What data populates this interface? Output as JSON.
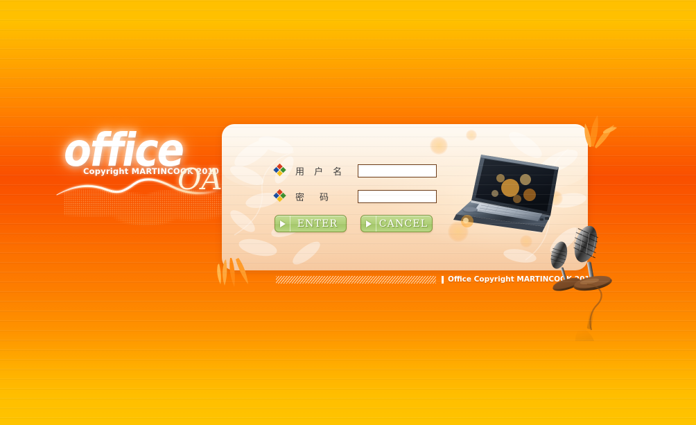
{
  "page": {
    "background_top_color": "#FFC000",
    "background_mid_color": "#FA5200",
    "background_bottom_color": "#FFC400"
  },
  "logo": {
    "word": "office",
    "copyright": "Copyright MARTINCOOK 2010",
    "suffix": "OA",
    "swoosh_icon": "light-swoosh",
    "map_icon": "halftone-world-map"
  },
  "panel": {
    "accent_color": "#FCE9D2",
    "border_color": "#F6C89F",
    "floral_icon": "floral-watermark",
    "laptop_icon": "laptop-illustration"
  },
  "form": {
    "rows": [
      {
        "icon": "windows-diamond-icon",
        "label": "用 户 名",
        "label_a": "密",
        "input_name": "username-input",
        "value": "",
        "placeholder": ""
      },
      {
        "icon": "windows-diamond-icon",
        "label": "密　码",
        "input_name": "password-input",
        "value": "",
        "placeholder": ""
      }
    ],
    "username_label": "用 户 名",
    "password_label_1": "密",
    "password_label_2": "码",
    "username_value": "",
    "password_value": "",
    "username_placeholder": "",
    "password_placeholder": ""
  },
  "buttons": {
    "submit_label": "ENTER",
    "cancel_label": "CANCEL",
    "arrow_icon": "play-triangle-icon",
    "fill_color": "#B4D37E",
    "border_color": "#7E9A3E"
  },
  "footer": {
    "separator": "|",
    "text": "Office Copyright MARTINCOOK 2010",
    "hatch_icon": "hatched-stripe-bar"
  },
  "decorations": {
    "leaves_top_right": "orange-leaves-icon",
    "leaves_bottom_left": "orange-leaves-icon",
    "microphones": "retro-microphones-icon"
  }
}
